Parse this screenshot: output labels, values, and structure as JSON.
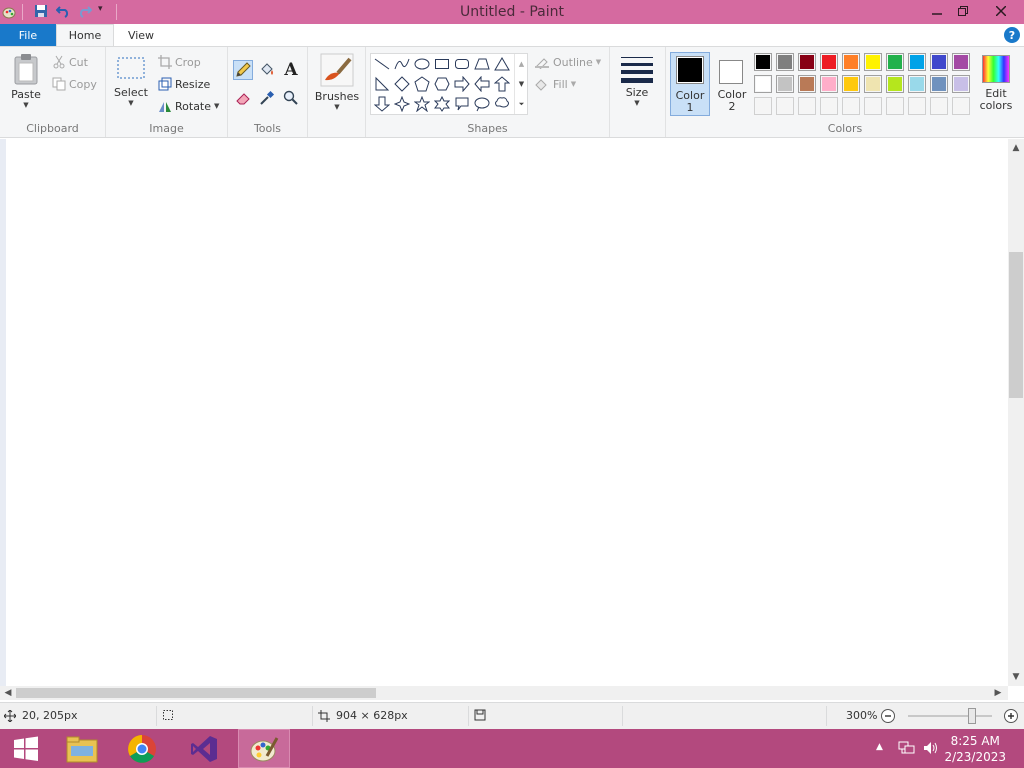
{
  "window": {
    "title": "Untitled - Paint",
    "min_icon": "minimize-icon",
    "restore_icon": "restore-icon",
    "close_icon": "close-icon"
  },
  "tabs": {
    "file": "File",
    "home": "Home",
    "view": "View"
  },
  "clipboard": {
    "paste": "Paste",
    "cut": "Cut",
    "copy": "Copy",
    "label": "Clipboard"
  },
  "image": {
    "select": "Select",
    "crop": "Crop",
    "resize": "Resize",
    "rotate": "Rotate",
    "label": "Image"
  },
  "tools": {
    "label": "Tools"
  },
  "brushes": {
    "label": "Brushes"
  },
  "shapes": {
    "outline": "Outline",
    "fill": "Fill",
    "label": "Shapes"
  },
  "size": {
    "label": "Size"
  },
  "colors": {
    "color1_a": "Color",
    "color1_b": "1",
    "color2_a": "Color",
    "color2_b": "2",
    "edit_a": "Edit",
    "edit_b": "colors",
    "label": "Colors",
    "color1_value": "#000000",
    "color2_value": "#ffffff",
    "palette_row1": [
      "#000000",
      "#7f7f7f",
      "#880015",
      "#ed1c24",
      "#ff7f27",
      "#fff200",
      "#22b14c",
      "#00a2e8",
      "#3f48cc",
      "#a349a4"
    ],
    "palette_row2": [
      "#ffffff",
      "#c3c3c3",
      "#b97a57",
      "#ffaec9",
      "#ffc90e",
      "#efe4b0",
      "#b5e61d",
      "#99d9ea",
      "#7092be",
      "#c8bfe7"
    ],
    "palette_row3": [
      "#f5f5f5",
      "#f5f5f5",
      "#f5f5f5",
      "#f5f5f5",
      "#f5f5f5",
      "#f5f5f5",
      "#f5f5f5",
      "#f5f5f5",
      "#f5f5f5",
      "#f5f5f5"
    ]
  },
  "status": {
    "cursor_pos": "20, 205px",
    "canvas_size": "904 × 628px",
    "zoom": "300%",
    "zoom_level_percent": 300
  },
  "taskbar": {
    "time": "8:25 AM",
    "date": "2/23/2023"
  }
}
